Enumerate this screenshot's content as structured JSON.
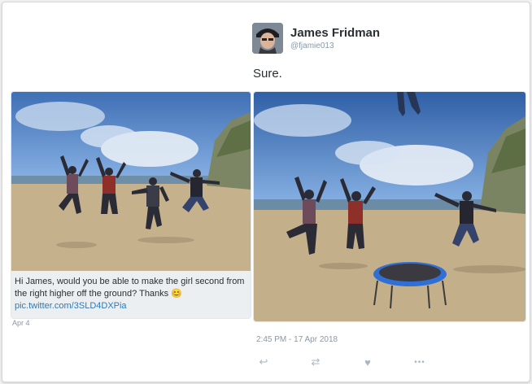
{
  "left_tweet": {
    "caption_text": "Hi James, would you be able to make the girl second from the right higher off the ground? Thanks ",
    "caption_emoji": "😊",
    "caption_link": "pic.twitter.com/3SLD4DXPia",
    "date": "Apr 4"
  },
  "right_tweet": {
    "author_name": "James Fridman",
    "author_handle": "@fjamie013",
    "text": "Sure.",
    "timestamp": "2:45 PM - 17 Apr 2018"
  },
  "actions": [
    {
      "name": "reply-icon",
      "glyph": "↩"
    },
    {
      "name": "retweet-icon",
      "glyph": "⇄"
    },
    {
      "name": "like-icon",
      "glyph": "♥"
    },
    {
      "name": "more-icon",
      "glyph": "•••"
    }
  ],
  "colors": {
    "text": "#292f33",
    "muted": "#8899a6",
    "link": "#2b7bb9",
    "caption_bg": "#eceff2",
    "sky": "#5b8fd1",
    "sand": "#c9b48f",
    "trampoline": "#2f6fd6"
  }
}
